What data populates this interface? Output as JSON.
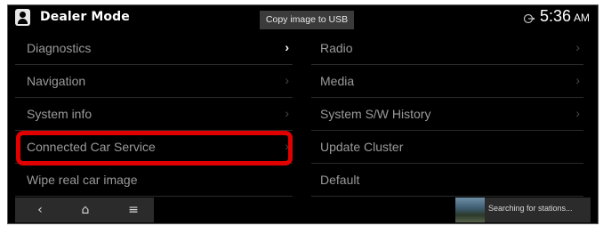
{
  "status_bar": {
    "title": "Dealer Mode",
    "copy_button": "Copy image to USB",
    "time": "5:36",
    "ampm": "AM"
  },
  "left_menu": [
    {
      "label": "Diagnostics",
      "chevron": "›"
    },
    {
      "label": "Navigation",
      "chevron": "›"
    },
    {
      "label": "System info",
      "chevron": "›"
    },
    {
      "label": "Connected Car Service",
      "chevron": "›"
    },
    {
      "label": "Wipe real car image",
      "chevron": ""
    }
  ],
  "right_menu": [
    {
      "label": "Radio",
      "chevron": "›"
    },
    {
      "label": "Media",
      "chevron": "›"
    },
    {
      "label": "System S/W History",
      "chevron": "›"
    },
    {
      "label": "Update Cluster",
      "chevron": ""
    },
    {
      "label": "Default",
      "chevron": ""
    }
  ],
  "nav": {
    "back": "‹",
    "home": "⌂",
    "menu": "≡"
  },
  "media_widget": {
    "status": "Searching for stations..."
  },
  "colors": {
    "highlight": "#e00000",
    "background": "#000000",
    "text": "#9a9a9a"
  }
}
